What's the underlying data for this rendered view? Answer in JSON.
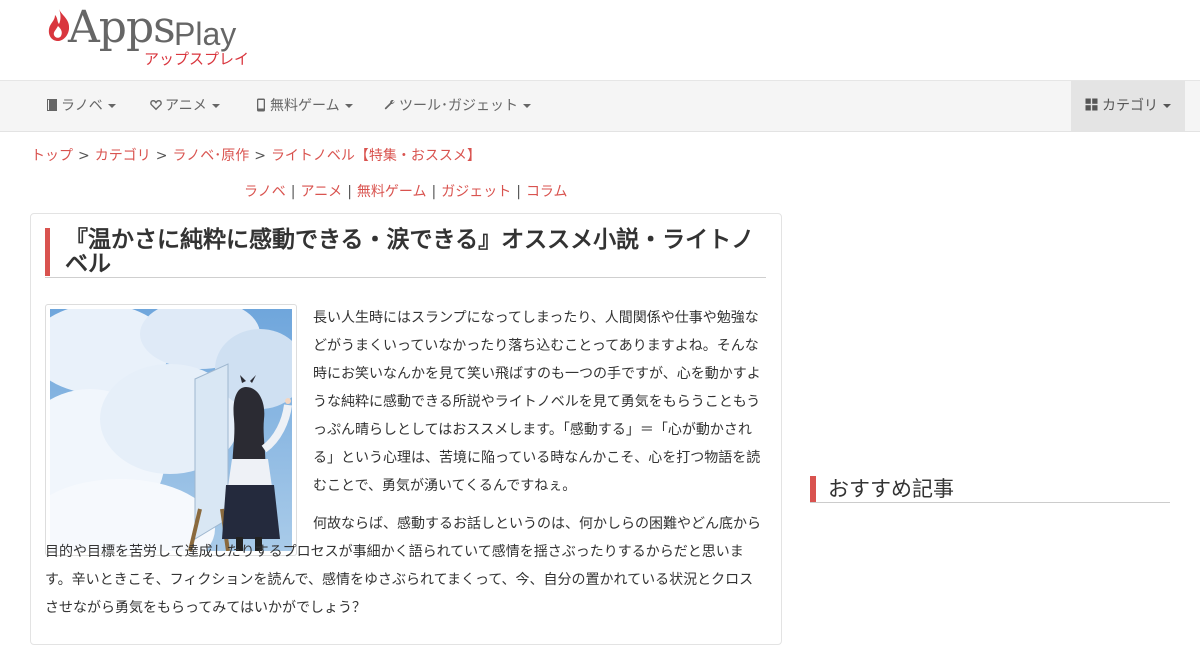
{
  "logo": {
    "apps": "Apps",
    "play": "Play",
    "kana": "アップスプレイ"
  },
  "nav": {
    "items": [
      {
        "label": "ラノベ",
        "icon": "book-icon"
      },
      {
        "label": "アニメ",
        "icon": "heart-icon"
      },
      {
        "label": "無料ゲーム",
        "icon": "mobile-icon"
      },
      {
        "label": "ツール･ガジェット",
        "icon": "wrench-icon"
      }
    ],
    "category": {
      "label": "カテゴリ",
      "icon": "grid-icon"
    }
  },
  "breadcrumb": {
    "items": [
      "トップ",
      "カテゴリ",
      "ラノベ･原作",
      "ライトノベル【特集・おススメ】"
    ],
    "separator": ">"
  },
  "category_links": [
    "ラノベ",
    "アニメ",
    "無料ゲーム",
    "ガジェット",
    "コラム"
  ],
  "article": {
    "title": "『温かさに純粋に感動できる・涙できる』オススメ小説・ライトノベル",
    "paragraph1": "長い人生時にはスランプになってしまったり、人間関係や仕事や勉強などがうまくいっていなかったり落ち込むことってありますよね。そんな時にお笑いなんかを見て笑い飛ばすのも一つの手ですが、心を動かすような純粋に感動できる所説やライトノベルを見て勇気をもらうこともうっぷん晴らしとしてはおススメします。「感動する」＝「心が動かされる」という心理は、苦境に陥っている時なんかこそ、心を打つ物語を読むことで、勇気が湧いてくるんですねぇ。",
    "paragraph2": "何故ならば、感動するお話しというのは、何かしらの困難やどん底から目的や目標を苦労して達成したりするプロセスが事細かく語られていて感情を揺さぶったりするからだと思います。辛いときこそ、フィクションを読んで、感情をゆさぶられてまくって、今、自分の置かれている状況とクロスさせながら勇気をもらってみてはいかがでしょう？"
  },
  "sidebar": {
    "heading": "おすすめ記事"
  },
  "colors": {
    "accent": "#d9534f",
    "navbar": "#f5f5f5"
  }
}
